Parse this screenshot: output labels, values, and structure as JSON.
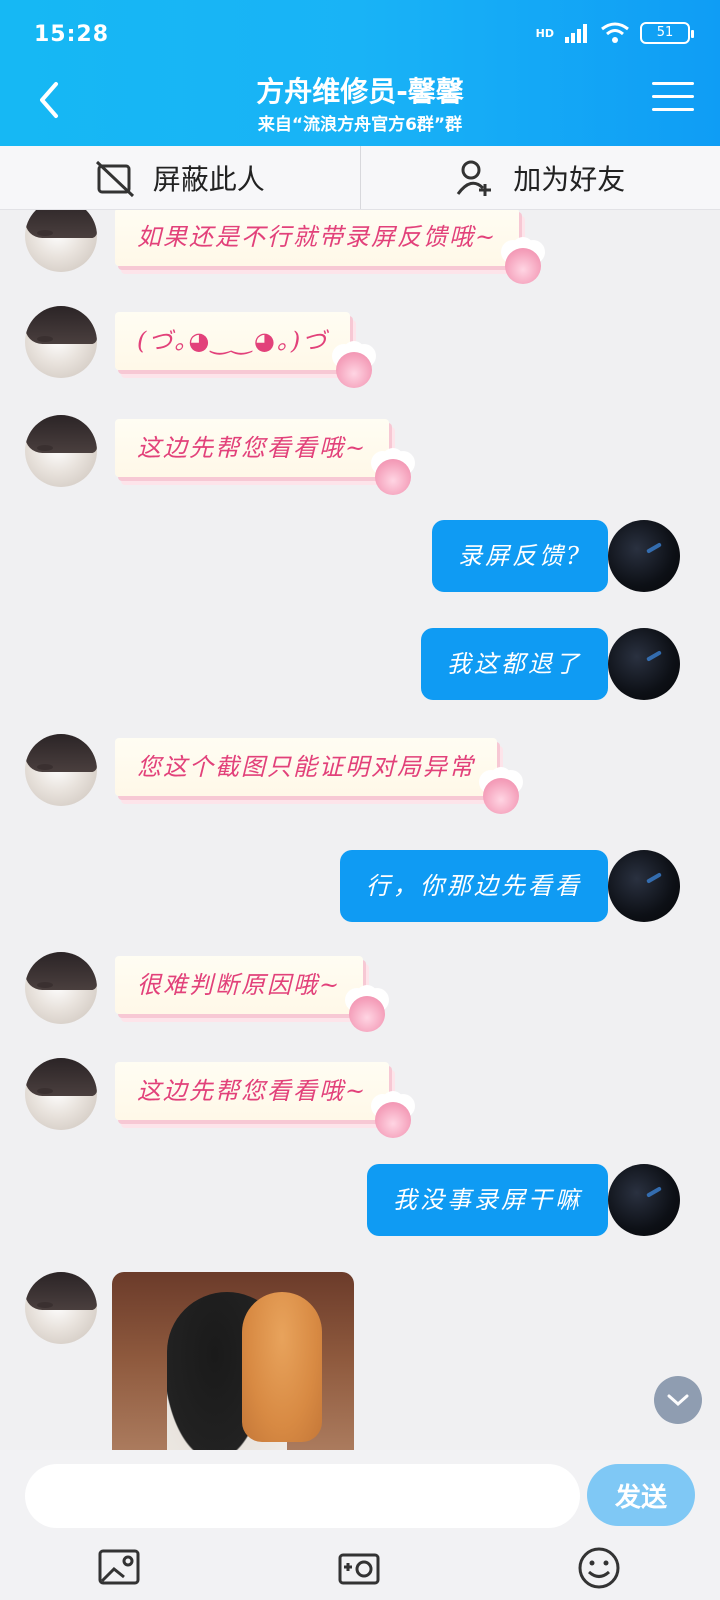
{
  "status_bar": {
    "time": "15:28",
    "network": "HD",
    "battery": "51"
  },
  "header": {
    "title": "方舟维修员-馨馨",
    "subtitle": "来自“流浪方舟官方6群”群"
  },
  "actions": {
    "block": "屏蔽此人",
    "add_friend": "加为好友"
  },
  "messages": [
    {
      "side": "left",
      "text": "如果还是不行就带录屏反馈哦~"
    },
    {
      "side": "left",
      "text": "(づ｡◕‿‿◕｡)づ"
    },
    {
      "side": "left",
      "text": "这边先帮您看看哦~"
    },
    {
      "side": "right",
      "text": "录屏反馈?"
    },
    {
      "side": "right",
      "text": "我这都退了"
    },
    {
      "side": "left",
      "text": "您这个截图只能证明对局异常"
    },
    {
      "side": "right",
      "text": "行，你那边先看看"
    },
    {
      "side": "left",
      "text": "很难判断原因哦~"
    },
    {
      "side": "left",
      "text": "这边先帮您看看哦~"
    },
    {
      "side": "right",
      "text": "我没事录屏干嘛"
    }
  ],
  "input": {
    "placeholder": "",
    "send_label": "发送"
  },
  "colors": {
    "header": "#16b8f4",
    "bubble_right": "#0f9bf3",
    "bubble_left_text": "#e2417a",
    "send_button": "#7fc8f5"
  },
  "icons": [
    "back-arrow-icon",
    "menu-icon",
    "block-icon",
    "add-friend-icon",
    "image-icon",
    "camera-icon",
    "emoji-icon",
    "chevron-down-icon"
  ]
}
